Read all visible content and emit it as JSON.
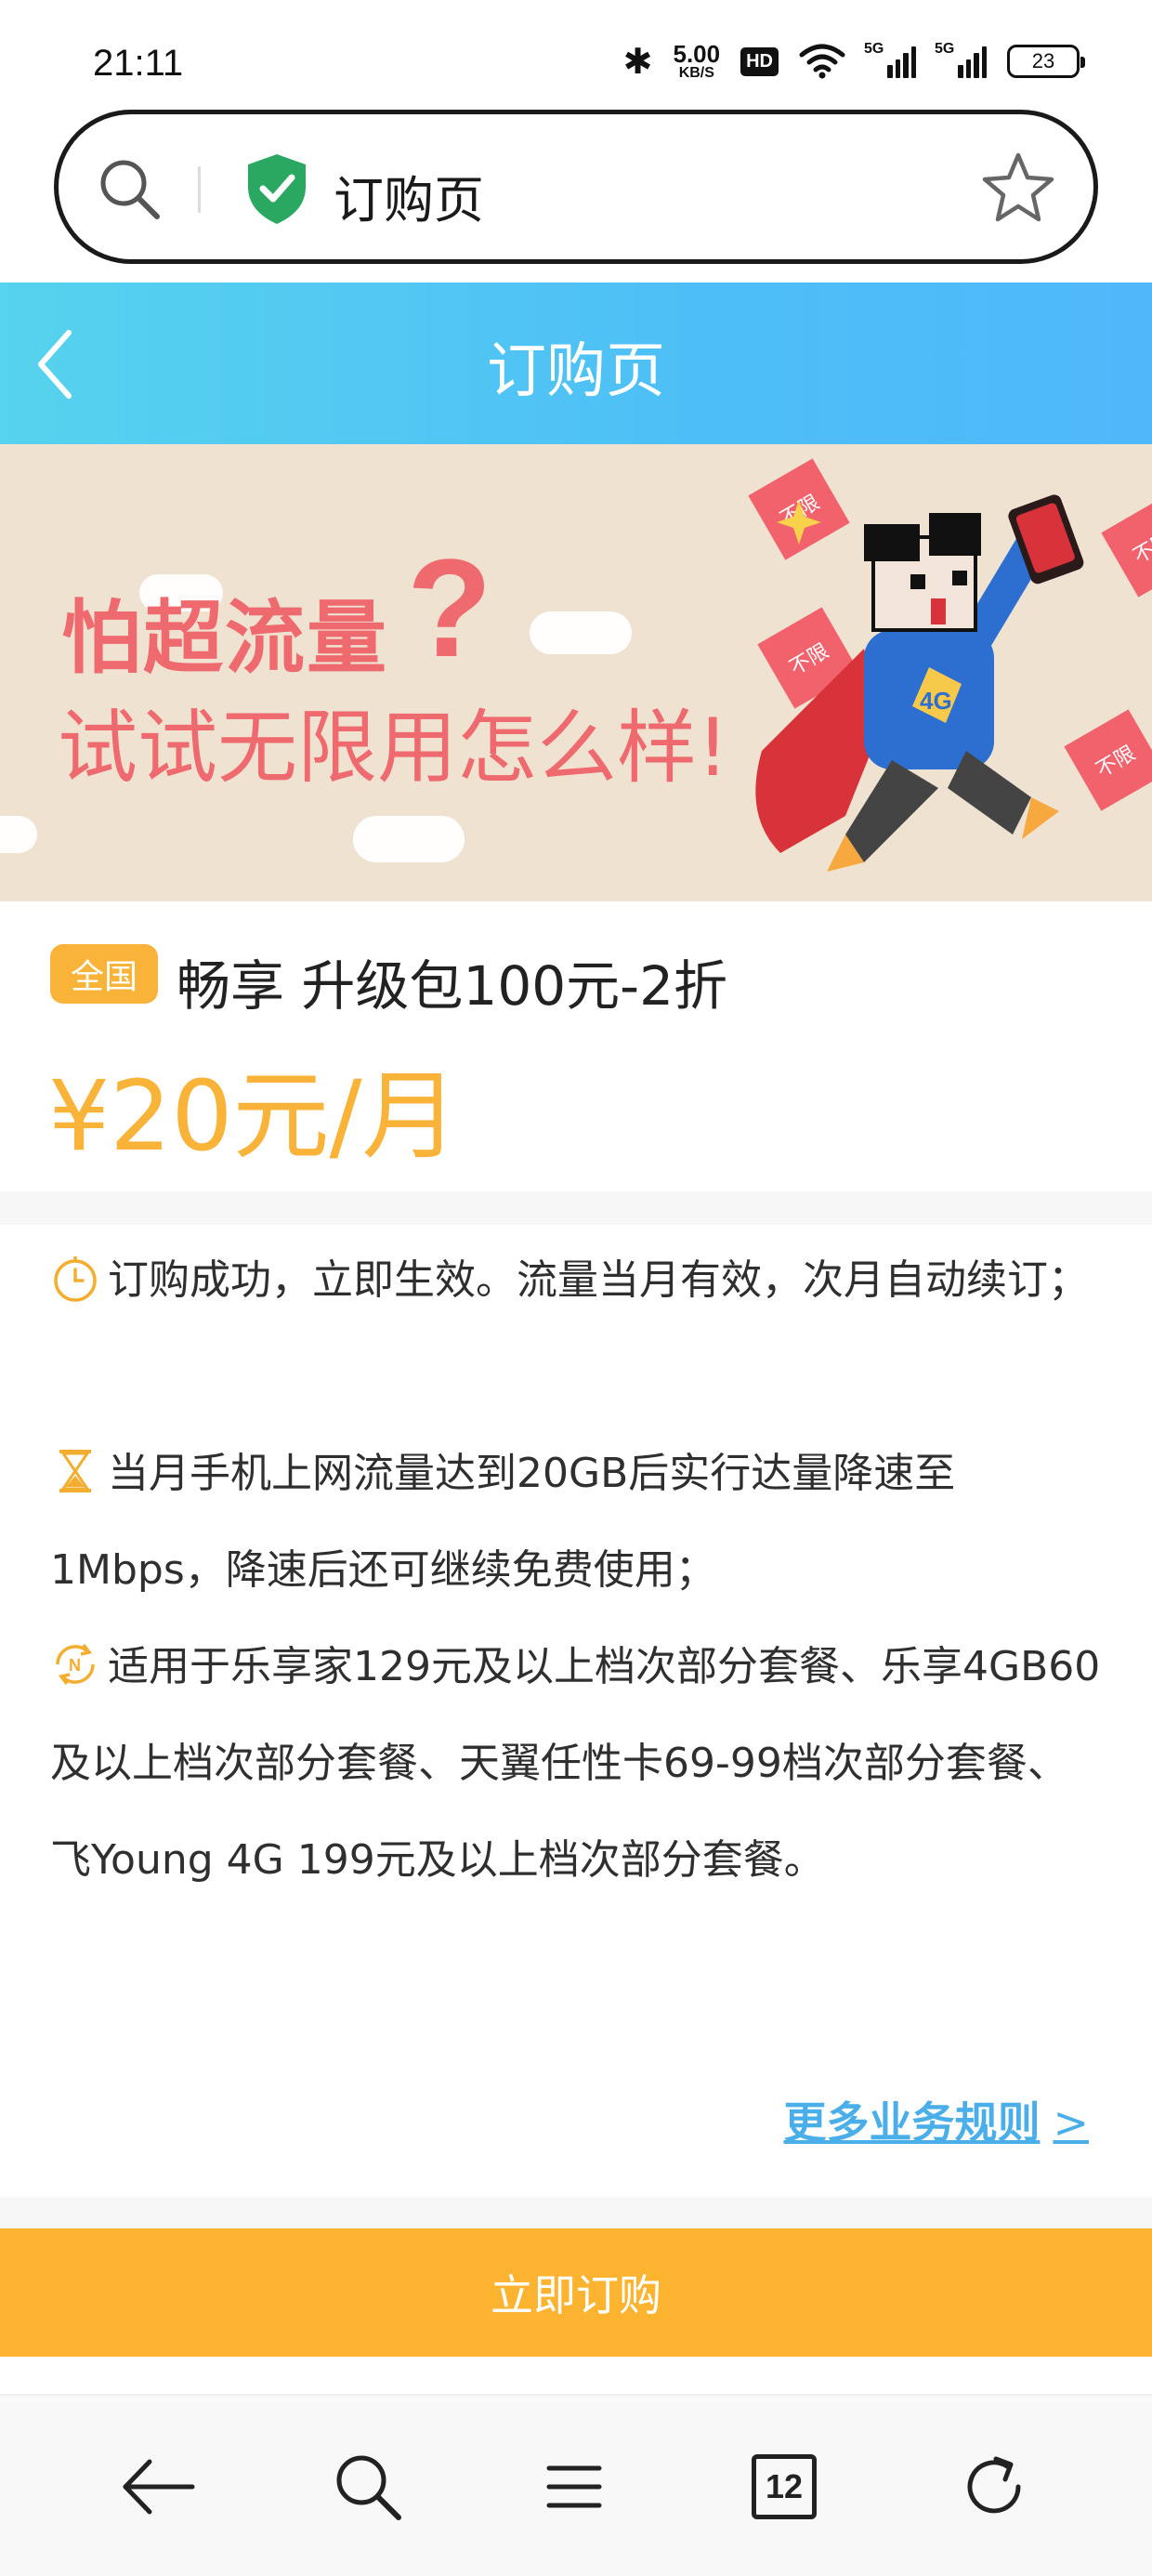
{
  "status_bar": {
    "time": "21:11",
    "net_speed_value": "5.00",
    "net_speed_unit": "KB/S",
    "hd_label": "HD",
    "signal1_label": "5G",
    "signal2_label": "5G",
    "battery": "23",
    "icons": [
      "bluetooth-icon",
      "wifi-icon",
      "signal-icon",
      "battery-icon"
    ]
  },
  "address_bar": {
    "title": "订购页",
    "icons": [
      "search-icon",
      "shield-check-icon",
      "star-icon"
    ]
  },
  "header": {
    "title": "订购页",
    "back_icon": "chevron-left-icon"
  },
  "banner": {
    "line1": "怕超流量",
    "qmark": "?",
    "line2": "试试无限用怎么样!",
    "card_text": "不限",
    "badge_text": "4G"
  },
  "product": {
    "region_badge": "全国",
    "name": "畅享 升级包100元-2折",
    "price": "¥20元/月"
  },
  "rules": {
    "items": [
      {
        "icon": "stopwatch-icon",
        "text": "订购成功，立即生效。流量当月有效，次月自动续订；"
      },
      {
        "icon": "hourglass-icon",
        "text": "当月手机上网流量达到20GB后实行达量降速至1Mbps，降速后还可继续免费使用；"
      },
      {
        "icon": "renew-icon",
        "text": "适用于乐享家129元及以上档次部分套餐、乐享4GB60及以上档次部分套餐、天翼任性卡69-99档次部分套餐、飞Young 4G 199元及以上档次部分套餐。"
      }
    ],
    "more_link": "更多业务规则",
    "more_chevron": ">"
  },
  "order_button": "立即订购",
  "bottom_nav": {
    "tab_count": "12",
    "icons": [
      "back-arrow-icon",
      "search-icon",
      "menu-icon",
      "tabs-icon",
      "refresh-icon"
    ]
  },
  "colors": {
    "header_gradient_start": "#56d3ee",
    "header_gradient_end": "#4fb8fb",
    "accent_orange": "#f8b338",
    "banner_bg": "#efe2d1",
    "banner_text": "#ee6a6f",
    "link_blue": "#4aaee8"
  }
}
